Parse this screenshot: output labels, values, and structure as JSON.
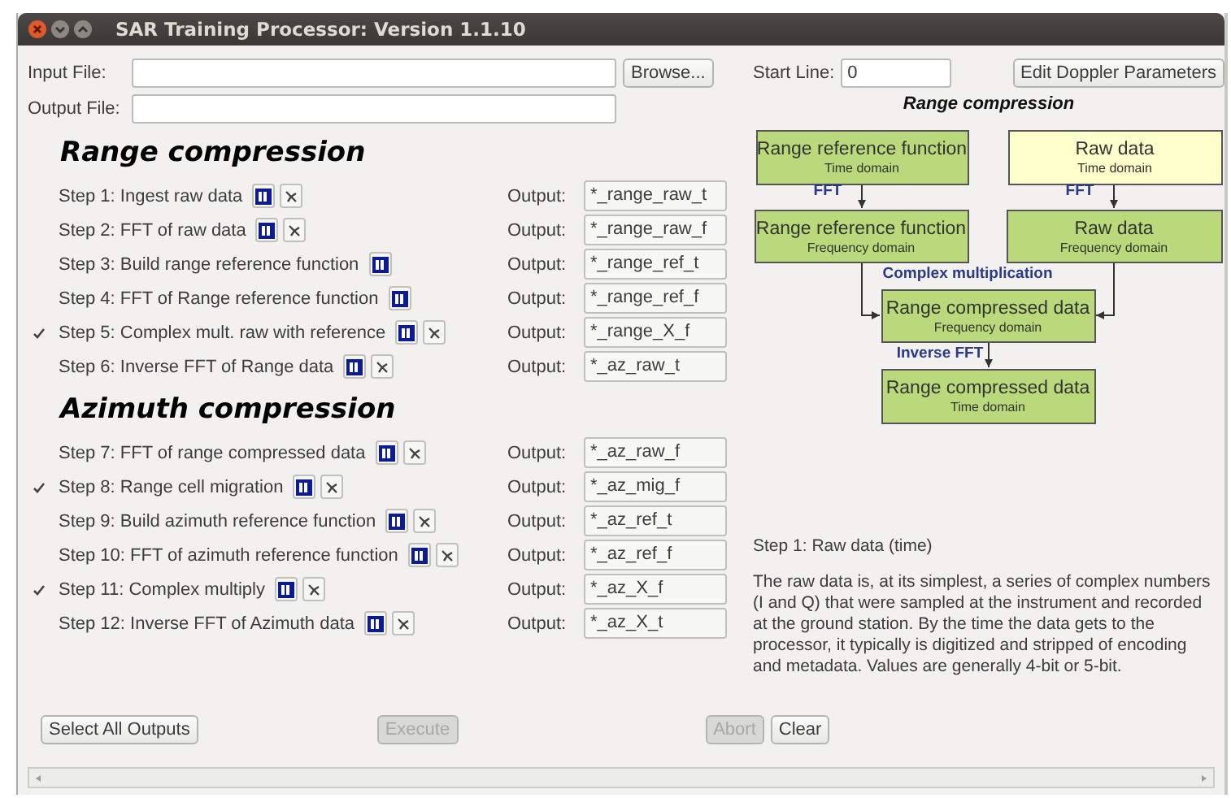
{
  "window": {
    "title": "SAR Training Processor: Version 1.1.10"
  },
  "input_file": {
    "label": "Input File:"
  },
  "output_file": {
    "label": "Output File:"
  },
  "browse_button": "Browse...",
  "start_line": {
    "label": "Start Line:",
    "value": "0"
  },
  "edit_doppler_button": "Edit Doppler Parameters",
  "sections": [
    {
      "title": "Range compression",
      "steps": [
        {
          "label": "Step 1: Ingest raw data",
          "checked": false,
          "buttons": [
            {
              "kind": "info"
            },
            {
              "kind": "tool"
            }
          ],
          "output_label": "Output:",
          "output": "*_range_raw_t"
        },
        {
          "label": "Step 2: FFT of raw data",
          "checked": false,
          "buttons": [
            {
              "kind": "info"
            },
            {
              "kind": "tool"
            }
          ],
          "output_label": "Output:",
          "output": "*_range_raw_f"
        },
        {
          "label": "Step 3: Build range reference function",
          "checked": false,
          "buttons": [
            {
              "kind": "info"
            }
          ],
          "output_label": "Output:",
          "output": "*_range_ref_t"
        },
        {
          "label": "Step 4: FFT of Range reference function",
          "checked": false,
          "buttons": [
            {
              "kind": "info"
            }
          ],
          "output_label": "Output:",
          "output": "*_range_ref_f"
        },
        {
          "label": "Step 5: Complex mult. raw with reference",
          "checked": true,
          "buttons": [
            {
              "kind": "info"
            },
            {
              "kind": "tool"
            }
          ],
          "output_label": "Output:",
          "output": "*_range_X_f"
        },
        {
          "label": "Step 6: Inverse FFT of Range data",
          "checked": false,
          "buttons": [
            {
              "kind": "info"
            },
            {
              "kind": "tool"
            }
          ],
          "output_label": "Output:",
          "output": "*_az_raw_t"
        }
      ]
    },
    {
      "title": "Azimuth compression",
      "steps": [
        {
          "label": "Step 7: FFT of range compressed data",
          "checked": false,
          "buttons": [
            {
              "kind": "info"
            },
            {
              "kind": "tool"
            }
          ],
          "output_label": "Output:",
          "output": "*_az_raw_f"
        },
        {
          "label": "Step 8: Range cell migration",
          "checked": true,
          "buttons": [
            {
              "kind": "info"
            },
            {
              "kind": "tool"
            }
          ],
          "output_label": "Output:",
          "output": "*_az_mig_f"
        },
        {
          "label": "Step 9: Build azimuth reference function",
          "checked": false,
          "buttons": [
            {
              "kind": "info"
            },
            {
              "kind": "tool"
            }
          ],
          "output_label": "Output:",
          "output": "*_az_ref_t"
        },
        {
          "label": "Step 10: FFT of azimuth reference function",
          "checked": false,
          "buttons": [
            {
              "kind": "info"
            },
            {
              "kind": "tool"
            }
          ],
          "output_label": "Output:",
          "output": "*_az_ref_f"
        },
        {
          "label": "Step 11: Complex multiply",
          "checked": true,
          "buttons": [
            {
              "kind": "info"
            },
            {
              "kind": "tool"
            }
          ],
          "output_label": "Output:",
          "output": "*_az_X_f"
        },
        {
          "label": "Step 12: Inverse FFT of Azimuth data",
          "checked": false,
          "buttons": [
            {
              "kind": "info"
            },
            {
              "kind": "tool"
            }
          ],
          "output_label": "Output:",
          "output": "*_az_X_t"
        }
      ]
    }
  ],
  "diagram": {
    "title": "Range compression",
    "nodes": [
      {
        "title": "Range reference function",
        "subtitle": "Time domain",
        "color": "#b9d97a"
      },
      {
        "title": "Raw data",
        "subtitle": "Time domain",
        "color": "#ffffcc"
      },
      {
        "title": "Range reference function",
        "subtitle": "Frequency domain",
        "color": "#b9d97a"
      },
      {
        "title": "Raw data",
        "subtitle": "Frequency domain",
        "color": "#b9d97a"
      },
      {
        "title": "Range compressed data",
        "subtitle": "Frequency domain",
        "color": "#b9d97a"
      },
      {
        "title": "Range compressed data",
        "subtitle": "Time domain",
        "color": "#b9d97a"
      }
    ],
    "labels": [
      "FFT",
      "FFT",
      "Complex multiplication",
      "Inverse FFT"
    ]
  },
  "description": {
    "heading": "Step 1: Raw data (time)",
    "body": "The raw data is, at its simplest, a series of complex numbers (I and Q) that were sampled at the instrument and recorded at the ground station. By the time the data gets to the processor, it typically is digitized and stripped of encoding and metadata. Values are generally 4-bit or 5-bit."
  },
  "buttons": [
    {
      "label": "Select All Outputs",
      "disabled": false
    },
    {
      "label": "Execute",
      "disabled": true
    },
    {
      "label": "Abort",
      "disabled": true
    },
    {
      "label": "Clear",
      "disabled": false
    }
  ]
}
